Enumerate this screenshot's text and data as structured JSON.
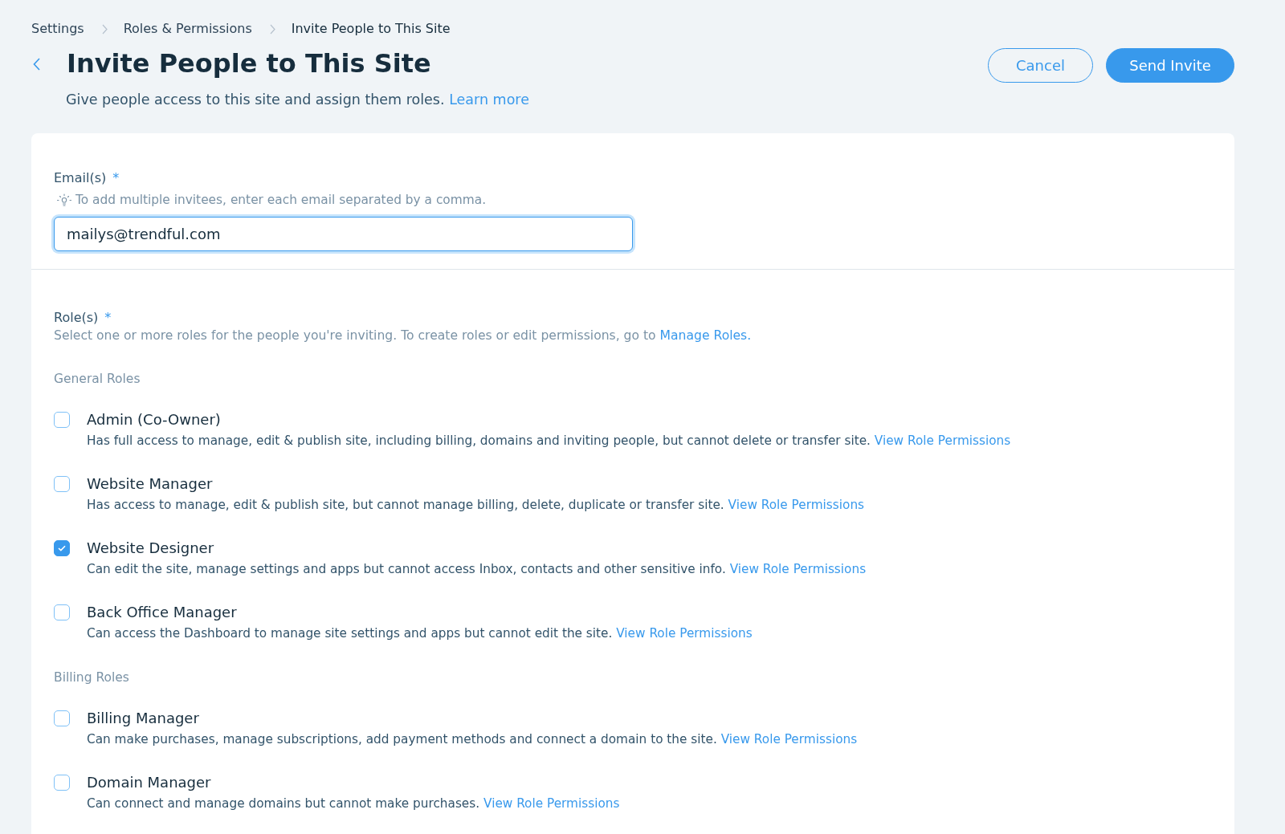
{
  "breadcrumbs": [
    {
      "label": "Settings",
      "current": false
    },
    {
      "label": "Roles & Permissions",
      "current": false
    },
    {
      "label": "Invite People to This Site",
      "current": true
    }
  ],
  "header": {
    "title": "Invite People to This Site",
    "subtitle": "Give people access to this site and assign them roles.",
    "subtitle_link": "Learn more"
  },
  "actions": [
    {
      "label": "Cancel",
      "kind": "secondary"
    },
    {
      "label": "Send Invite",
      "kind": "primary"
    }
  ],
  "email": {
    "label": "Email(s)",
    "required_mark": "*",
    "hint": "To add multiple invitees, enter each email separated by a comma.",
    "value": "mailys@trendful.com",
    "focused": true
  },
  "roles": {
    "label": "Role(s)",
    "required_mark": "*",
    "description": "Select one or more roles for the people you're inviting. To create roles or edit permissions, go to",
    "description_link": "Manage Roles.",
    "groups": [
      {
        "title": "General Roles",
        "items": [
          {
            "name": "Admin (Co-Owner)",
            "description": "Has full access to manage, edit & publish site, including billing, domains and inviting people, but cannot delete or transfer site.",
            "link": "View Role Permissions",
            "checked": false
          },
          {
            "name": "Website Manager",
            "description": "Has access to manage, edit & publish site, but cannot manage billing, delete, duplicate or transfer site.",
            "link": "View Role Permissions",
            "checked": false
          },
          {
            "name": "Website Designer",
            "description": "Can edit the site, manage settings and apps but cannot access Inbox, contacts and other sensitive info.",
            "link": "View Role Permissions",
            "checked": true
          },
          {
            "name": "Back Office Manager",
            "description": "Can access the Dashboard to manage site settings and apps but cannot edit the site.",
            "link": "View Role Permissions",
            "checked": false
          }
        ]
      },
      {
        "title": "Billing Roles",
        "items": [
          {
            "name": "Billing Manager",
            "description": "Can make purchases, manage subscriptions, add payment methods and connect a domain to the site.",
            "link": "View Role Permissions",
            "checked": false
          },
          {
            "name": "Domain Manager",
            "description": "Can connect and manage domains but cannot make purchases.",
            "link": "View Role Permissions",
            "checked": false
          }
        ]
      }
    ]
  }
}
